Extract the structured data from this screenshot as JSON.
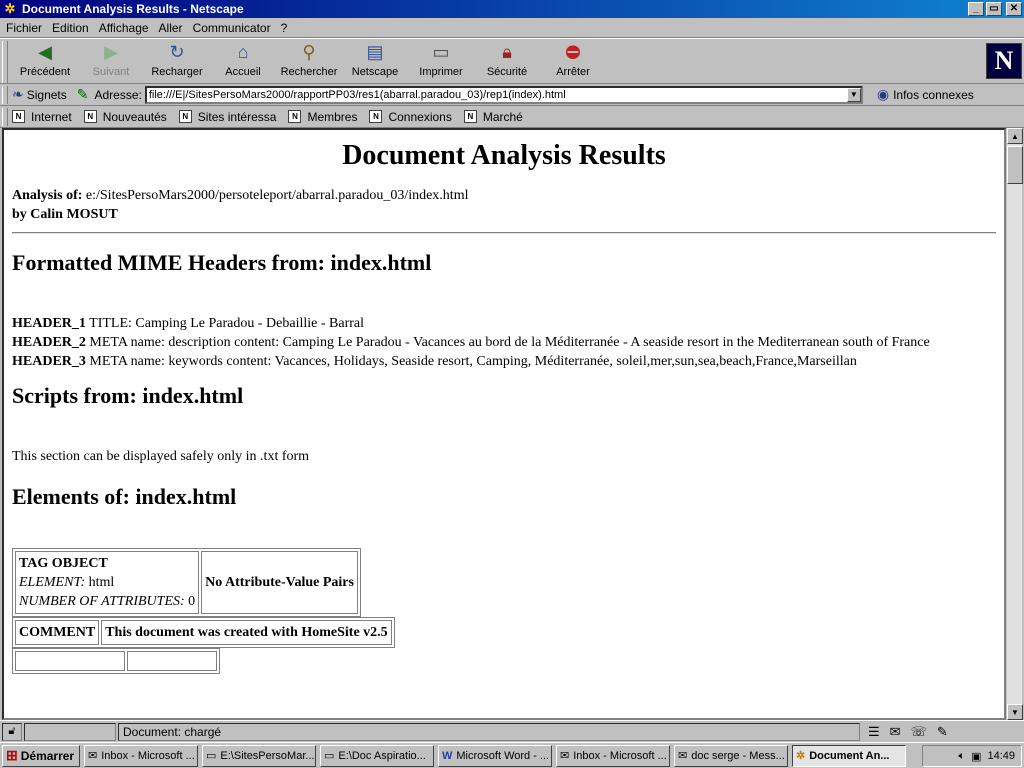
{
  "window": {
    "title": "Document Analysis Results - Netscape",
    "buttons": {
      "minimize": "_",
      "maximize": "▭",
      "close": "✕"
    }
  },
  "menubar": {
    "items": [
      {
        "label": "Fichier"
      },
      {
        "label": "Edition"
      },
      {
        "label": "Affichage"
      },
      {
        "label": "Aller"
      },
      {
        "label": "Communicator"
      },
      {
        "label": "?"
      }
    ]
  },
  "toolbar": {
    "buttons": [
      {
        "label": "Précédent",
        "icon": "back-arrow-icon",
        "enabled": true
      },
      {
        "label": "Suivant",
        "icon": "forward-arrow-icon",
        "enabled": false
      },
      {
        "label": "Recharger",
        "icon": "reload-icon",
        "enabled": true
      },
      {
        "label": "Accueil",
        "icon": "home-icon",
        "enabled": true
      },
      {
        "label": "Rechercher",
        "icon": "search-icon",
        "enabled": true
      },
      {
        "label": "Netscape",
        "icon": "netscape-icon",
        "enabled": true
      },
      {
        "label": "Imprimer",
        "icon": "print-icon",
        "enabled": true
      },
      {
        "label": "Sécurité",
        "icon": "lock-icon",
        "enabled": true
      },
      {
        "label": "Arrêter",
        "icon": "stop-icon",
        "enabled": true
      }
    ],
    "logo": "N"
  },
  "location": {
    "bookmarks_label": "Signets",
    "address_label": "Adresse:",
    "url": "file:///E|/SitesPersoMars2000/rapportPP03/res1(abarral.paradou_03)/rep1(index).html",
    "related_label": "Infos connexes"
  },
  "personal_toolbar": {
    "items": [
      {
        "label": "Internet"
      },
      {
        "label": "Nouveautés"
      },
      {
        "label": "Sites intéressa"
      },
      {
        "label": "Membres"
      },
      {
        "label": "Connexions"
      },
      {
        "label": "Marché"
      }
    ]
  },
  "page": {
    "title": "Document Analysis Results",
    "analysis_label": "Analysis of:",
    "analysis_path": "e:/SitesPersoMars2000/persoteleport/abarral.paradou_03/index.html",
    "byline": "by Calin MOSUT",
    "headers_heading": "Formatted MIME Headers from: index.html",
    "headers": [
      {
        "key": "HEADER_1",
        "value": "TITLE: Camping Le Paradou - Debaillie - Barral"
      },
      {
        "key": "HEADER_2",
        "value": "META name: description content: Camping Le Paradou - Vacances au bord de la Méditerranée - A seaside resort in the Mediterranean south of France"
      },
      {
        "key": "HEADER_3",
        "value": "META name: keywords content: Vacances, Holidays, Seaside resort, Camping, Méditerranée, soleil,mer,sun,sea,beach,France,Marseillan"
      }
    ],
    "scripts_heading": "Scripts from: index.html",
    "scripts_note": "This section can be displayed safely only in .txt form",
    "elements_heading": "Elements of: index.html",
    "tag_table": {
      "tag_object": "TAG OBJECT",
      "element_label": "ELEMENT:",
      "element_value": "html",
      "num_attr_label": "NUMBER OF ATTRIBUTES:",
      "num_attr_value": "0",
      "no_pairs": "No Attribute-Value Pairs"
    },
    "comment_table": {
      "label": "COMMENT",
      "value": "This document was created with HomeSite v2.5"
    }
  },
  "statusbar": {
    "text": "Document: chargé"
  },
  "taskbar": {
    "start_label": "Démarrer",
    "tasks": [
      {
        "label": "Inbox - Microsoft ...",
        "icon": "mail-icon",
        "active": false
      },
      {
        "label": "E:\\SitesPersoMar...",
        "icon": "folder-icon",
        "active": false
      },
      {
        "label": "E:\\Doc Aspiratio...",
        "icon": "folder-icon",
        "active": false
      },
      {
        "label": "Microsoft Word - ...",
        "icon": "word-icon",
        "active": false
      },
      {
        "label": "Inbox - Microsoft ...",
        "icon": "mail-icon",
        "active": false
      },
      {
        "label": "doc serge - Mess...",
        "icon": "message-icon",
        "active": false
      },
      {
        "label": "Document An...",
        "icon": "netscape-icon",
        "active": true
      }
    ],
    "clock": "14:49"
  }
}
